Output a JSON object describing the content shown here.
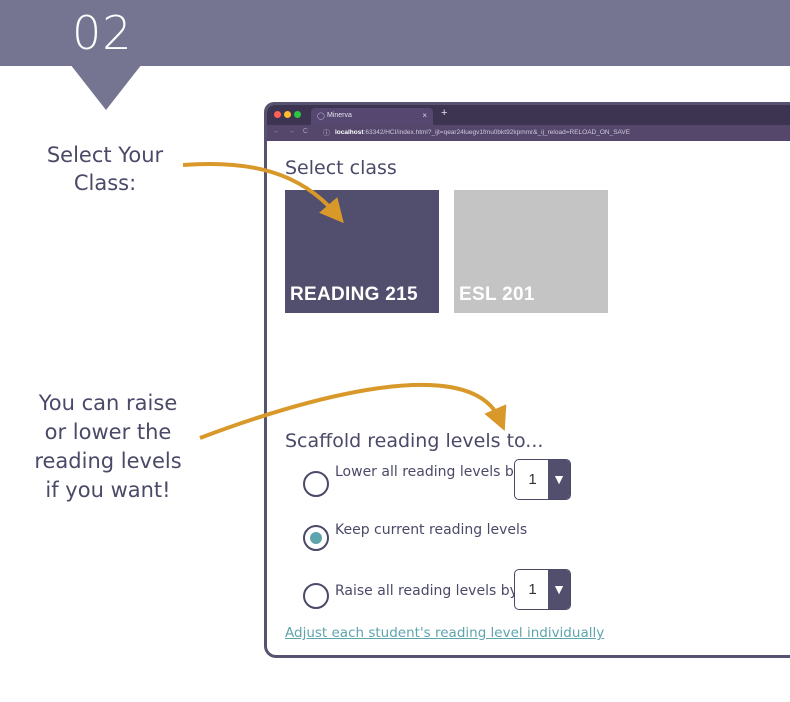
{
  "step": {
    "number": "02"
  },
  "callouts": {
    "select_class": [
      "Select Your",
      "Class:"
    ],
    "scaffold": [
      "You can raise",
      "or lower the",
      "reading levels",
      "if you want!"
    ]
  },
  "browser": {
    "tab_title": "Minerva",
    "tab_close": "×",
    "new_tab": "+",
    "nav_glyphs": "← → C",
    "url_host": "localhost",
    "url_rest": ":63342/HCI/index.html?_ijt=qear24luegv1fmu0bkt92kpmmr&_ij_reload=RELOAD_ON_SAVE"
  },
  "select_class": {
    "title": "Select class",
    "classes": [
      {
        "label": "READING 215",
        "selected": true
      },
      {
        "label": "ESL 201",
        "selected": false
      }
    ]
  },
  "scaffold": {
    "title": "Scaffold reading levels to...",
    "options": [
      {
        "label": "Lower all reading levels by",
        "selected": false,
        "stepper_value": "1"
      },
      {
        "label": "Keep current reading levels",
        "selected": true
      },
      {
        "label": "Raise all reading levels by",
        "selected": false,
        "stepper_value": "1"
      }
    ],
    "stepper_icon": "▼",
    "adjust_link": "Adjust each student's reading level individually"
  },
  "colors": {
    "banner": "#757491",
    "card_selected": "#524e6e",
    "card_unselected": "#c4c4c4",
    "accent_teal": "#5ea4ad",
    "callout_arrow": "#d9992a"
  }
}
